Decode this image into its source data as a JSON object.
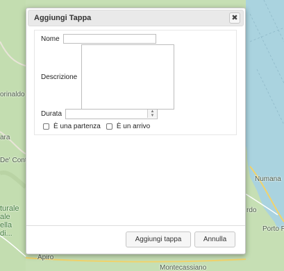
{
  "map": {
    "labels": [
      "orinaldo",
      "ara",
      "De' Cont",
      "turale",
      "ale",
      "ella",
      "di...",
      "Apiro",
      "Numana",
      "Porto R",
      "rdo",
      "Montecassiano"
    ],
    "colors": {
      "land": "#c6dfb4",
      "sea": "#aad3df",
      "road": "#f2d36b"
    }
  },
  "dialog": {
    "title": "Aggiungi Tappa",
    "close_icon": "close-icon",
    "fields": {
      "nome_label": "Nome",
      "nome_value": "",
      "descrizione_label": "Descrizione",
      "descrizione_value": "",
      "durata_label": "Durata",
      "durata_value": ""
    },
    "checkboxes": {
      "partenza_label": "È una partenza",
      "partenza_checked": false,
      "arrivo_label": "È un arrivo",
      "arrivo_checked": false
    },
    "buttons": {
      "add_label": "Aggiungi tappa",
      "cancel_label": "Annulla"
    }
  }
}
